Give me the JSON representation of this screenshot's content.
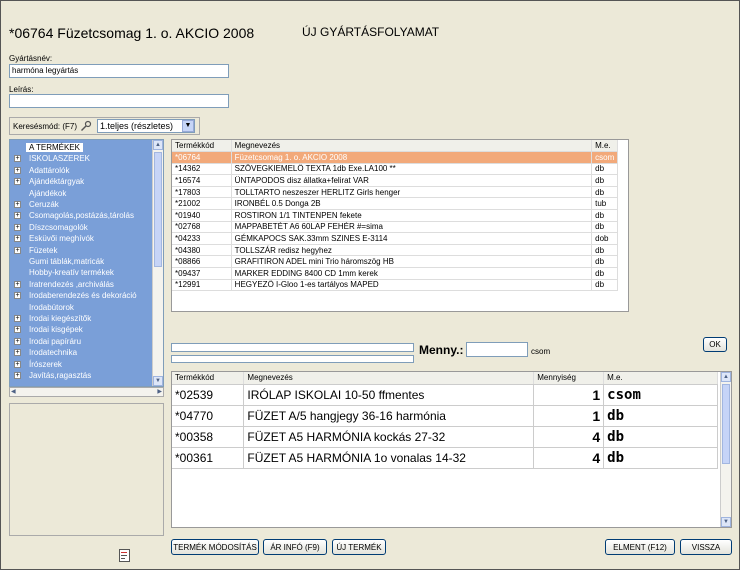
{
  "header": {
    "product_title": "*06764 Füzetcsomag  1. o.  AKCIO 2008",
    "mode_title": "ÚJ GYÁRTÁSFOLYAMAT"
  },
  "form": {
    "name_label": "Gyártásnév:",
    "name_value": "harmóna legyártás",
    "desc_label": "Leírás:",
    "desc_value": "",
    "search_mode_label": "Keresésmód: (F7)",
    "search_mode_value": "1.teljes (részletes)"
  },
  "tree": {
    "items": [
      {
        "label": "A TERMÉKEK",
        "expander": "",
        "selected": true
      },
      {
        "label": "ISKOLASZEREK",
        "expander": "+"
      },
      {
        "label": "Adattárolók",
        "expander": "+"
      },
      {
        "label": "Ajándéktárgyak",
        "expander": "+"
      },
      {
        "label": "Ajándékok",
        "expander": ""
      },
      {
        "label": "Ceruzák",
        "expander": "+"
      },
      {
        "label": "Csomagolás,postázás,tárolás",
        "expander": "+"
      },
      {
        "label": "Díszcsomagolók",
        "expander": "+"
      },
      {
        "label": "Esküvői meghívók",
        "expander": "+"
      },
      {
        "label": "Füzetek",
        "expander": "+"
      },
      {
        "label": "Gumi táblák,matricák",
        "expander": ""
      },
      {
        "label": "Hobby-kreatív termékek",
        "expander": ""
      },
      {
        "label": "Iratrendezés ,archiválás",
        "expander": "+"
      },
      {
        "label": "Irodaberendezés és dekoráció",
        "expander": "+"
      },
      {
        "label": "Irodabútorok",
        "expander": ""
      },
      {
        "label": "Irodai kiegészítők",
        "expander": "+"
      },
      {
        "label": "Irodai kisgépek",
        "expander": "+"
      },
      {
        "label": "Irodai papíráru",
        "expander": "+"
      },
      {
        "label": "Irodatechnika",
        "expander": "+"
      },
      {
        "label": "Írószerek",
        "expander": "+"
      },
      {
        "label": "Javítás,ragasztás",
        "expander": "+"
      }
    ]
  },
  "products": {
    "headers": [
      "Termékkód",
      "Megnevezés",
      "M.e."
    ],
    "rows": [
      {
        "code": "*06764",
        "name": "Füzetcsomag  1. o.  AKCIO 2008",
        "unit": "csom",
        "selected": true
      },
      {
        "code": "*14362",
        "name": "SZÖVEGKIEMELŐ TEXTA 1db Exe.LA100 **",
        "unit": "db"
      },
      {
        "code": "*16574",
        "name": "ÜNTAPODOS disz állatka+felirat  VAR",
        "unit": "db"
      },
      {
        "code": "*17803",
        "name": "TOLLTARTO neszeszer HERLITZ Girls henger",
        "unit": "db"
      },
      {
        "code": "*21002",
        "name": "IRONBÉL 0.5 Donga     2B",
        "unit": "tub"
      },
      {
        "code": "*01940",
        "name": "ROSTIRON 1/1 TINTENPEN      fekete",
        "unit": "db"
      },
      {
        "code": "*02768",
        "name": "MAPPABETÉT A6 60LAP FEHÉR #=sima",
        "unit": "db"
      },
      {
        "code": "*04233",
        "name": "GÉMKAPOCS SAK.33mm SZINES     E-3114",
        "unit": "dob"
      },
      {
        "code": "*04380",
        "name": "TOLLSZÁR  redisz hegyhez",
        "unit": "db"
      },
      {
        "code": "*08866",
        "name": "GRAFITIRON ADEL mini Trio  háromszög HB",
        "unit": "db"
      },
      {
        "code": "*09437",
        "name": "MARKER EDDING 8400 CD   1mm   kerek",
        "unit": "db"
      },
      {
        "code": "*12991",
        "name": "HEGYEZŐ I-Gloo  1-es tartályos      MAPED",
        "unit": "db"
      }
    ]
  },
  "qty_entry": {
    "label": "Menny.:",
    "value": "",
    "unit": "csom",
    "ok_label": "OK"
  },
  "components": {
    "headers": [
      "Termékkód",
      "Megnevezés",
      "Mennyiség",
      "M.e."
    ],
    "rows": [
      {
        "code": "*02539",
        "name": "IRÓLAP ISKOLAI 10-50 ffmentes",
        "qty": "1",
        "unit": "csom"
      },
      {
        "code": "*04770",
        "name": "FÜZET A/5 hangjegy   36-16  harmónia",
        "qty": "1",
        "unit": "db"
      },
      {
        "code": "*00358",
        "name": "FÜZET A5  HARMÓNIA   kockás     27-32",
        "qty": "4",
        "unit": "db"
      },
      {
        "code": "*00361",
        "name": "FÜZET A5  HARMÓNIA   1o vonalas   14-32",
        "qty": "4",
        "unit": "db"
      }
    ]
  },
  "buttons": {
    "modify": "TERMÉK MÓDOSÍTÁS",
    "price_info": "ÁR INFÓ (F9)",
    "new_product": "ÚJ TERMÉK",
    "save": "ELMENT (F12)",
    "back": "VISSZA"
  },
  "icons": {
    "search_mode": "key-icon",
    "dropdown": "chevron-down-icon",
    "status": "document-icon"
  }
}
